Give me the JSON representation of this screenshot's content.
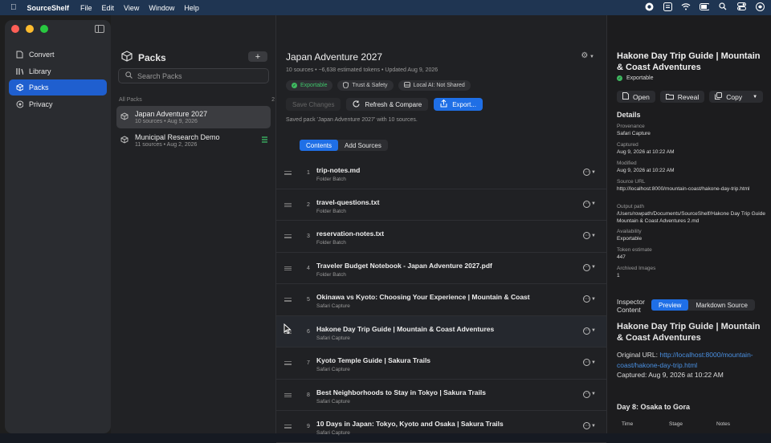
{
  "menubar": {
    "app": "SourceShelf",
    "items": [
      "File",
      "Edit",
      "View",
      "Window",
      "Help"
    ]
  },
  "sidebar": {
    "items": [
      {
        "label": "Convert",
        "icon": "doc-arrow-icon"
      },
      {
        "label": "Library",
        "icon": "books-icon"
      },
      {
        "label": "Packs",
        "icon": "cube-icon"
      },
      {
        "label": "Privacy",
        "icon": "privacy-icon"
      }
    ],
    "selected": "Packs"
  },
  "packs": {
    "title": "Packs",
    "search_placeholder": "Search Packs",
    "group_label": "All Packs",
    "group_count": "2",
    "items": [
      {
        "name": "Japan Adventure 2027",
        "meta": "10 sources • Aug 9, 2026"
      },
      {
        "name": "Municipal Research Demo",
        "meta": "11 sources • Aug 2, 2026"
      }
    ]
  },
  "main": {
    "title": "Japan Adventure 2027",
    "meta": "10 sources  •  ~6,638 estimated tokens  •  Updated Aug 9, 2026",
    "chips": [
      "Exportable",
      "Trust & Safety",
      "Local AI: Not Shared"
    ],
    "buttons": {
      "save": "Save Changes",
      "refresh": "Refresh & Compare",
      "export": "Export..."
    },
    "saved_message": "Saved pack 'Japan Adventure 2027' with 10 sources.",
    "tabs": [
      "Contents",
      "Add Sources"
    ],
    "rows": [
      {
        "num": "1",
        "title": "trip-notes.md",
        "sub": "Folder Batch"
      },
      {
        "num": "2",
        "title": "travel-questions.txt",
        "sub": "Folder Batch"
      },
      {
        "num": "3",
        "title": "reservation-notes.txt",
        "sub": "Folder Batch"
      },
      {
        "num": "4",
        "title": "Traveler Budget Notebook - Japan Adventure 2027.pdf",
        "sub": "Folder Batch"
      },
      {
        "num": "5",
        "title": "Okinawa vs Kyoto: Choosing Your Experience | Mountain & Coast",
        "sub": "Safari Capture"
      },
      {
        "num": "6",
        "title": "Hakone Day Trip Guide | Mountain & Coast Adventures",
        "sub": "Safari Capture"
      },
      {
        "num": "7",
        "title": "Kyoto Temple Guide | Sakura Trails",
        "sub": "Safari Capture"
      },
      {
        "num": "8",
        "title": "Best Neighborhoods to Stay in Tokyo | Sakura Trails",
        "sub": "Safari Capture"
      },
      {
        "num": "9",
        "title": "10 Days in Japan: Tokyo, Kyoto and Osaka | Sakura Trails",
        "sub": "Safari Capture"
      }
    ]
  },
  "inspector": {
    "title": "Hakone Day Trip Guide | Mountain & Coast Adventures",
    "status": "Exportable",
    "buttons": {
      "open": "Open",
      "reveal": "Reveal",
      "copy": "Copy"
    },
    "details_heading": "Details",
    "details": [
      {
        "k": "Provenance",
        "v": "Safari Capture"
      },
      {
        "k": "Captured",
        "v": "Aug 9, 2026 at 10:22 AM"
      },
      {
        "k": "Modified",
        "v": "Aug 9, 2026 at 10:22 AM"
      },
      {
        "k": "Source URL",
        "v": "http://localhost:8000/mountain-coast/hakone-day-trip.html"
      },
      {
        "k": "Output path",
        "v": "/Users/rowpath/Documents/SourceShelf/Hakone Day Trip Guide Mountain & Coast Adventures 2.md"
      },
      {
        "k": "Availability",
        "v": "Exportable"
      },
      {
        "k": "Token estimate",
        "v": "447"
      },
      {
        "k": "Archived Images",
        "v": "1"
      }
    ],
    "content_label_1": "Inspector",
    "content_label_2": "Content",
    "tabs": [
      "Preview",
      "Markdown Source"
    ],
    "preview_title": "Hakone Day Trip Guide | Mountain & Coast Adventures",
    "orig_label": "Original URL: ",
    "orig_url": "http://localhost:8000/mountain-coast/hakone-day-trip.html",
    "captured_line": "Captured: Aug 9, 2026 at 10:22 AM",
    "day_heading": "Day 8: Osaka to Gora",
    "table_headers": [
      "Time",
      "Stage",
      "Notes"
    ]
  }
}
